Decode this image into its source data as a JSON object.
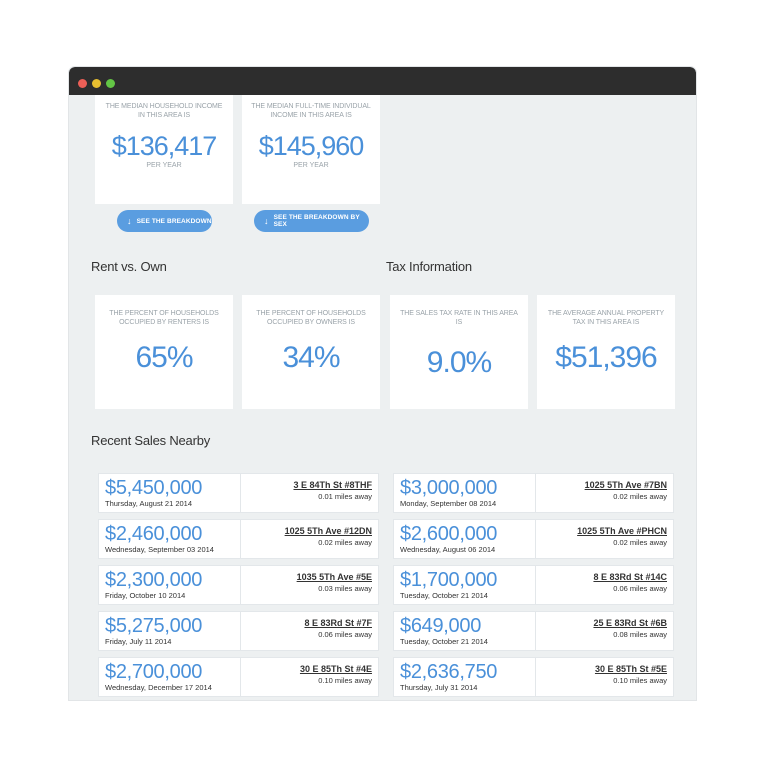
{
  "window": {
    "controls": [
      "close",
      "minimize",
      "maximize"
    ]
  },
  "income": {
    "cards": [
      {
        "caption": "THE MEDIAN HOUSEHOLD INCOME IN THIS AREA IS",
        "value": "$136,417",
        "unit": "PER YEAR",
        "button": "SEE THE BREAKDOWN"
      },
      {
        "caption": "THE MEDIAN FULL-TIME INDIVIDUAL INCOME IN THIS AREA IS",
        "value": "$145,960",
        "unit": "PER YEAR",
        "button": "SEE THE BREAKDOWN BY SEX"
      }
    ]
  },
  "rent_vs_own": {
    "title": "Rent vs. Own",
    "cards": [
      {
        "caption": "THE PERCENT OF HOUSEHOLDS OCCUPIED BY RENTERS IS",
        "value": "65%"
      },
      {
        "caption": "THE PERCENT OF HOUSEHOLDS OCCUPIED BY OWNERS IS",
        "value": "34%"
      }
    ]
  },
  "tax": {
    "title": "Tax Information",
    "cards": [
      {
        "caption": "THE SALES TAX RATE IN THIS AREA IS",
        "value": "9.0%"
      },
      {
        "caption": "THE AVERAGE ANNUAL PROPERTY TAX IN THIS AREA IS",
        "value": "$51,396"
      }
    ]
  },
  "recent_sales": {
    "title": "Recent Sales Nearby",
    "left": [
      {
        "price": "$5,450,000",
        "date": "Thursday, August 21 2014",
        "address": "3 E 84Th St #8THF",
        "distance": "0.01 miles away"
      },
      {
        "price": "$2,460,000",
        "date": "Wednesday, September 03 2014",
        "address": "1025 5Th Ave #12DN",
        "distance": "0.02 miles away"
      },
      {
        "price": "$2,300,000",
        "date": "Friday, October 10 2014",
        "address": "1035 5Th Ave #5E",
        "distance": "0.03 miles away"
      },
      {
        "price": "$5,275,000",
        "date": "Friday, July 11 2014",
        "address": "8 E 83Rd St #7F",
        "distance": "0.06 miles away"
      },
      {
        "price": "$2,700,000",
        "date": "Wednesday, December 17 2014",
        "address": "30 E 85Th St #4E",
        "distance": "0.10 miles away"
      }
    ],
    "right": [
      {
        "price": "$3,000,000",
        "date": "Monday, September 08 2014",
        "address": "1025 5Th Ave #7BN",
        "distance": "0.02 miles away"
      },
      {
        "price": "$2,600,000",
        "date": "Wednesday, August 06 2014",
        "address": "1025 5Th Ave #PHCN",
        "distance": "0.02 miles away"
      },
      {
        "price": "$1,700,000",
        "date": "Tuesday, October 21 2014",
        "address": "8 E 83Rd St #14C",
        "distance": "0.06 miles away"
      },
      {
        "price": "$649,000",
        "date": "Tuesday, October 21 2014",
        "address": "25 E 83Rd St #6B",
        "distance": "0.08 miles away"
      },
      {
        "price": "$2,636,750",
        "date": "Thursday, July 31 2014",
        "address": "30 E 85Th St #5E",
        "distance": "0.10 miles away"
      }
    ]
  }
}
